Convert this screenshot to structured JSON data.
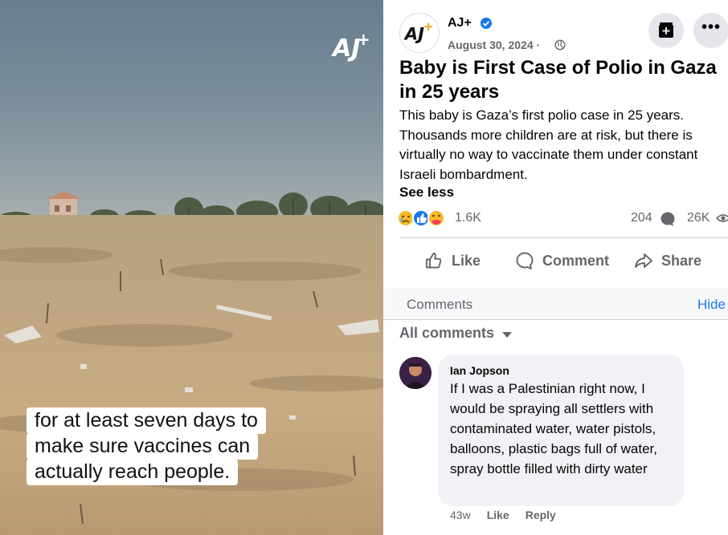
{
  "video": {
    "watermark_text": "AJ+",
    "caption_lines": [
      "for at least seven days to",
      "make sure vaccines can",
      "actually reach people."
    ]
  },
  "post": {
    "page_name": "AJ+",
    "date": "August 30, 2024 ·",
    "title": "Baby is First Case of Polio in Gaza in 25 years",
    "body": "This baby is Gaza’s first polio case in 25 years. Thousands more children are at risk, but there is virtually no way to vaccinate them under constant Israeli bombardment.",
    "see_less": "See less",
    "reactions_count": "1.6K",
    "comments_count": "204",
    "views_count": "26K",
    "reaction_icons": [
      "sad-face-icon",
      "thumbs-up-icon",
      "care-face-icon"
    ],
    "actions": {
      "like": "Like",
      "comment": "Comment",
      "share": "Share"
    },
    "comments_section": {
      "label": "Comments",
      "hide": "Hide",
      "sort": "All comments"
    },
    "comment": {
      "author": "Ian Jopson",
      "text": "If I was a Palestinian right now, I would be spraying all settlers with contaminated water, water pistols, balloons, plastic bags full of water, spray bottle filled with dirty water",
      "age": "43w",
      "like": "Like",
      "reply": "Reply"
    }
  },
  "colors": {
    "facebook_blue": "#1877f2",
    "meta_gray": "#65676b",
    "aj_orange": "#f6a01a"
  }
}
